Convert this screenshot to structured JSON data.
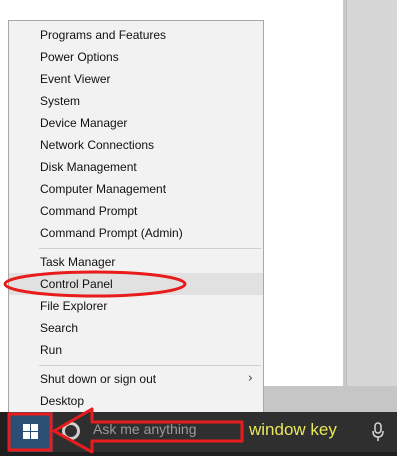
{
  "context_menu": {
    "items": [
      {
        "label": "Programs and Features"
      },
      {
        "label": "Power Options"
      },
      {
        "label": "Event Viewer"
      },
      {
        "label": "System"
      },
      {
        "label": "Device Manager"
      },
      {
        "label": "Network Connections"
      },
      {
        "label": "Disk Management"
      },
      {
        "label": "Computer Management"
      },
      {
        "label": "Command Prompt"
      },
      {
        "label": "Command Prompt (Admin)"
      },
      {
        "label": "Task Manager"
      },
      {
        "label": "Control Panel",
        "highlighted": true
      },
      {
        "label": "File Explorer"
      },
      {
        "label": "Search"
      },
      {
        "label": "Run"
      },
      {
        "label": "Shut down or sign out",
        "has_submenu": true
      },
      {
        "label": "Desktop"
      }
    ]
  },
  "taskbar": {
    "search_placeholder": "Ask me anything",
    "start_icon": "windows-logo-icon",
    "search_icon": "cortana-circle-icon",
    "mic_icon": "microphone-icon"
  },
  "annotation": {
    "label": "window key",
    "color": "#e81c1c",
    "label_color": "#e8e85a"
  }
}
